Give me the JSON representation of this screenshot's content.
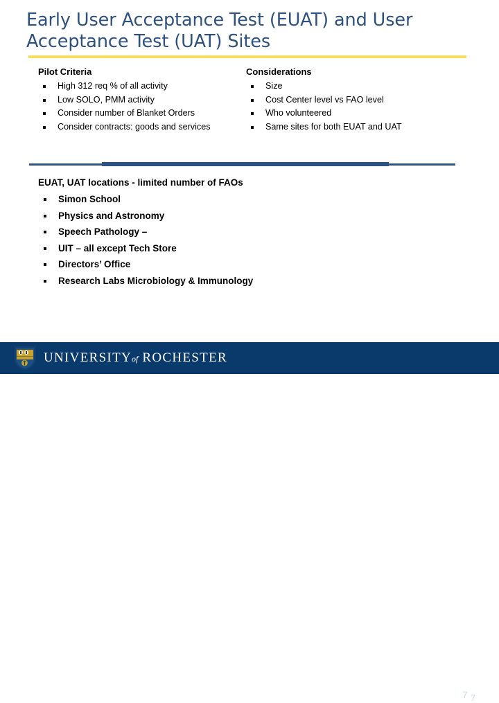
{
  "slide": {
    "title": "Early User Acceptance Test (EUAT) and User Acceptance Test (UAT) Sites",
    "title_color": "#2e5280",
    "accent_rule_color": "#f6dc5f",
    "divider_color": "#2e5280"
  },
  "columns": {
    "left": {
      "heading": "Pilot Criteria",
      "items": [
        "High 312 req % of all activity",
        "Low SOLO, PMM activity",
        "Consider number of Blanket Orders",
        "Consider contracts: goods and services"
      ]
    },
    "right": {
      "heading": "Considerations",
      "items": [
        "Size",
        "Cost Center level vs FAO level",
        "Who volunteered",
        "Same sites for both EUAT and UAT"
      ]
    }
  },
  "lower": {
    "heading": "EUAT, UAT locations -  limited number of FAOs",
    "items": [
      "Simon School",
      "Physics and Astronomy",
      "Speech Pathology –",
      "UIT – all except Tech Store",
      "Directors’ Office",
      "Research Labs Microbiology & Immunology"
    ]
  },
  "footer": {
    "background_color": "#0a3a6b",
    "wordmark_first": "UNIVERSITY",
    "wordmark_of": "of",
    "wordmark_last": "ROCHESTER",
    "crest_label": "university-crest",
    "page_number": "7",
    "page_number_shadow": "7"
  }
}
